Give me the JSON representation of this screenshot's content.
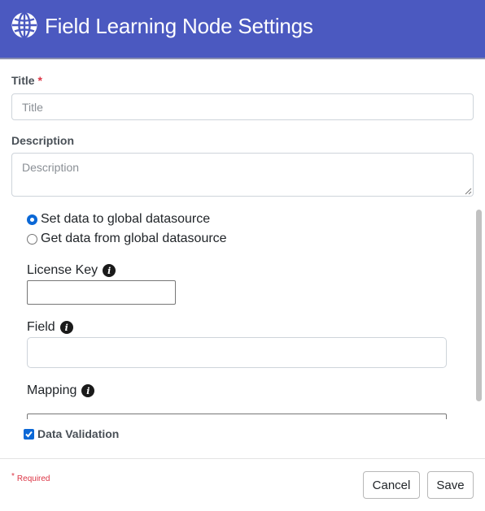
{
  "header": {
    "title": "Field Learning Node Settings",
    "icon": "globe-icon"
  },
  "form": {
    "title_label": "Title",
    "title_required_mark": "*",
    "title_placeholder": "Title",
    "description_label": "Description",
    "description_placeholder": "Description"
  },
  "settings": {
    "radio_options": [
      {
        "label": "Set data to global datasource",
        "checked": true
      },
      {
        "label": "Get data from global datasource",
        "checked": false
      }
    ],
    "license_key_label": "License Key",
    "field_label": "Field",
    "mapping_label": "Mapping",
    "info_icon_glyph": "i"
  },
  "validation": {
    "label": "Data Validation",
    "checked": true
  },
  "footer": {
    "required_star": "*",
    "required_text": "Required",
    "cancel_label": "Cancel",
    "save_label": "Save"
  },
  "colors": {
    "header_bg": "#4b59c0",
    "accent": "#0b68d6",
    "required": "#dc3545"
  }
}
